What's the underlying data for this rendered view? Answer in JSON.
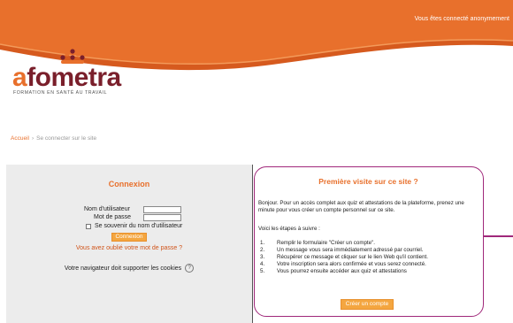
{
  "header": {
    "login_status": "Vous êtes connecté anonymement",
    "colors": {
      "band": "#e8702c",
      "band_dark": "#d65a1e"
    }
  },
  "logo": {
    "wordmark_first": "a",
    "wordmark_rest": "fometra",
    "tagline": "FORMATION EN SANTÉ AU TRAVAIL",
    "colors": {
      "orange": "#e8702c",
      "maroon": "#7a1f2b"
    }
  },
  "breadcrumb": {
    "home": "Accueil",
    "separator": "›",
    "current": "Se connecter sur le site"
  },
  "login": {
    "title": "Connexion",
    "username_label": "Nom d'utilisateur",
    "username_value": "",
    "password_label": "Mot de passe",
    "password_value": "",
    "remember_label": "Se souvenir du nom d'utilisateur",
    "remember_checked": false,
    "submit_label": "Connexion",
    "forgot_link": "Vous avez oublié votre mot de passe ?",
    "cookies_note": "Votre navigateur doit supporter les cookies",
    "help_icon": "question-circle-icon"
  },
  "first_visit": {
    "title": "Première visite sur ce site ?",
    "intro": "Bonjour. Pour un accès complet aux quiz et attestations de la plateforme, prenez une minute pour vous créer un compte personnel sur ce site.",
    "steps_intro": "Voici les étapes à suivre :",
    "steps": [
      {
        "num": "1.",
        "text": "Remplir le formulaire \"Créer un compte\"."
      },
      {
        "num": "2.",
        "text": "Un message vous sera immédiatement adressé par courriel."
      },
      {
        "num": "3.",
        "text": "Récupérer ce message et cliquer sur le lien Web qu'il contient."
      },
      {
        "num": "4.",
        "text": "Votre inscription sera alors confirmée et vous serez connecté."
      },
      {
        "num": "5.",
        "text": "Vous pourrez ensuite accéder aux quiz et attestations"
      }
    ],
    "create_button": "Créer un compte",
    "colors": {
      "border": "#a0287a"
    }
  }
}
